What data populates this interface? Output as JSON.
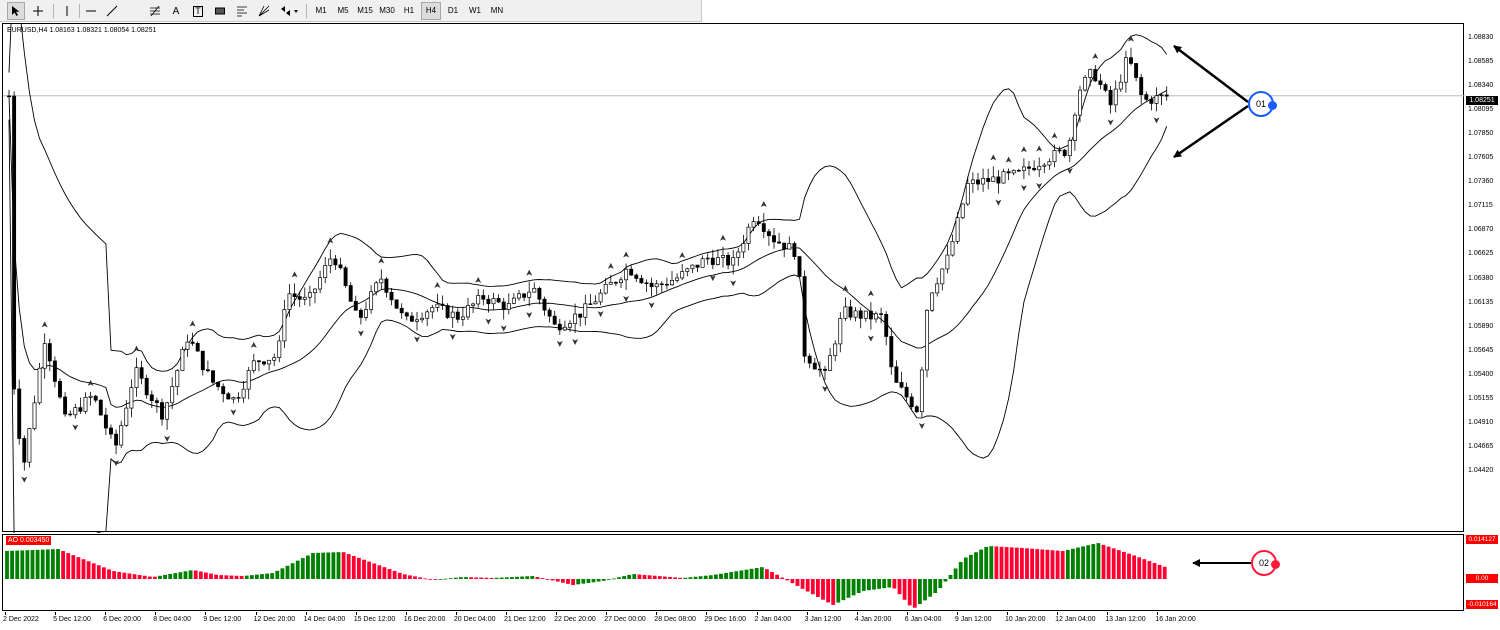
{
  "toolbar": {
    "timeframes": [
      "M1",
      "M5",
      "M15",
      "M30",
      "H1",
      "H4",
      "D1",
      "W1",
      "MN"
    ],
    "active_timeframe": "H4",
    "text_tool_label": "A",
    "label_tool_label": "T"
  },
  "chart": {
    "symbol_info": "EURUSD,H4  1.08163 1.08321 1.08054 1.08251",
    "current_price": "1.08251",
    "price_labels": [
      "1.08830",
      "1.08585",
      "1.08340",
      "1.08095",
      "1.07850",
      "1.07605",
      "1.07360",
      "1.07115",
      "1.06870",
      "1.06625",
      "1.06380",
      "1.06135",
      "1.05890",
      "1.05645",
      "1.05400",
      "1.05155",
      "1.04910",
      "1.04665",
      "1.04420"
    ],
    "time_labels": [
      "2 Dec 2022",
      "5 Dec 12:00",
      "6 Dec 20:00",
      "8 Dec 04:00",
      "9 Dec 12:00",
      "12 Dec 20:00",
      "14 Dec 04:00",
      "15 Dec 12:00",
      "16 Dec 20:00",
      "20 Dec 04:00",
      "21 Dec 12:00",
      "22 Dec 20:00",
      "27 Dec 00:00",
      "28 Dec 08:00",
      "29 Dec 16:00",
      "2 Jan 04:00",
      "3 Jan 12:00",
      "4 Jan 20:00",
      "6 Jan 04:00",
      "9 Jan 12:00",
      "10 Jan 20:00",
      "12 Jan 04:00",
      "13 Jan 12:00",
      "16 Jan 20:00"
    ]
  },
  "indicator": {
    "label": "AO 0.003450",
    "top_value": "0.014127",
    "zero_value": "0.00",
    "bottom_value": "-0.010164",
    "colors": {
      "up": "#008000",
      "down": "#ff0030"
    }
  },
  "annotations": {
    "callout1": {
      "label": "01",
      "color": "#1a5cff"
    },
    "callout2": {
      "label": "02",
      "color": "#ff1a3c"
    }
  }
}
